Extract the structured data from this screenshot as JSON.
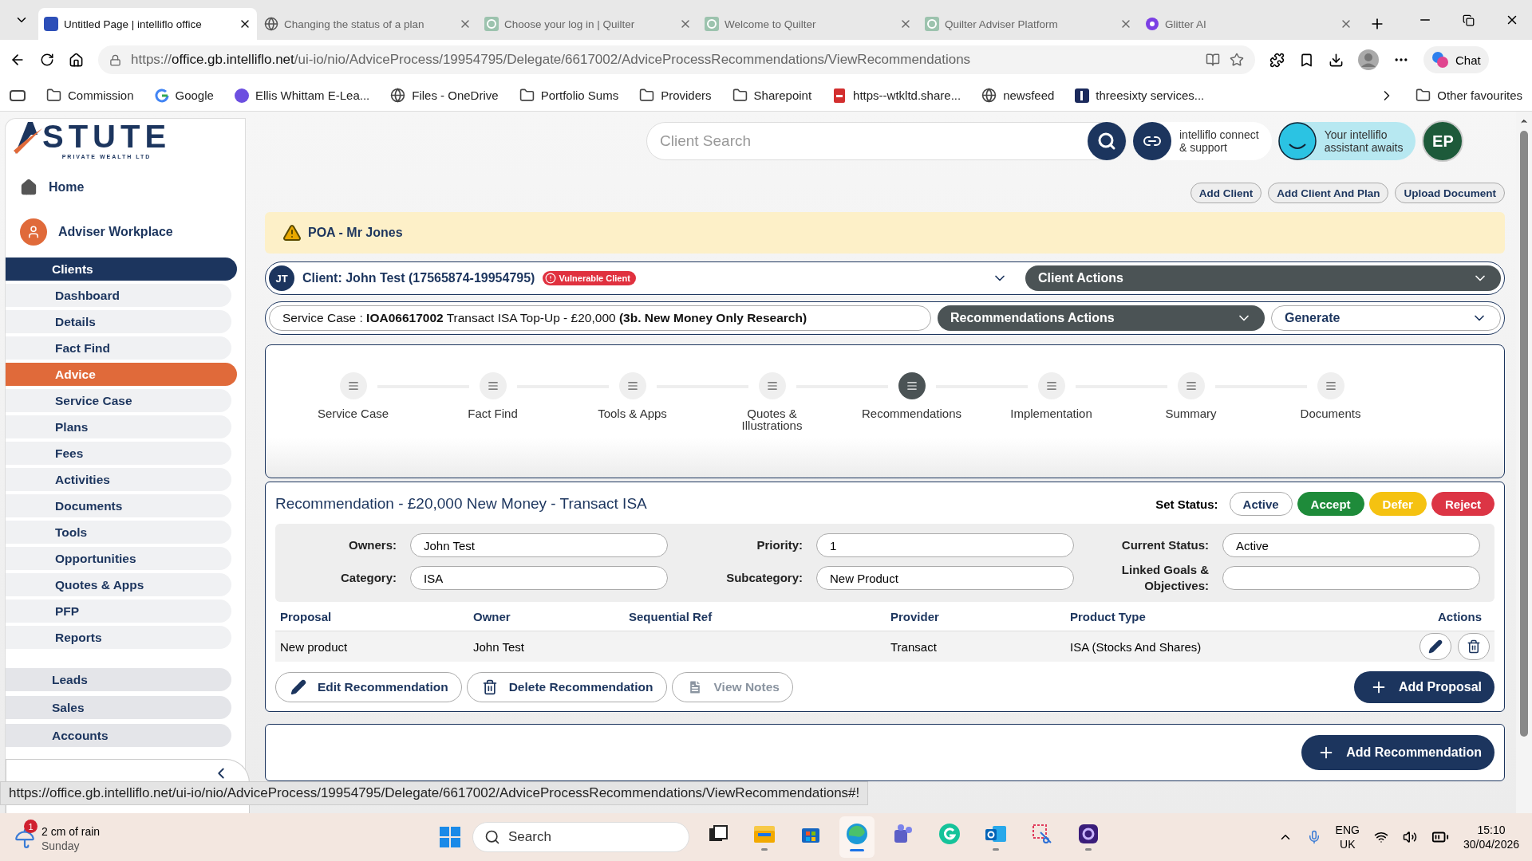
{
  "browser": {
    "tabs": [
      {
        "title": "Untitled Page | intelliflo office",
        "kind": "intelliflo",
        "selected": true
      },
      {
        "title": "Changing the status of a plan",
        "kind": "globe",
        "selected": false
      },
      {
        "title": "Choose your log in | Quilter",
        "kind": "quilter",
        "selected": false
      },
      {
        "title": "Welcome to Quilter",
        "kind": "quilter",
        "selected": false
      },
      {
        "title": "Quilter Adviser Platform",
        "kind": "quilter",
        "selected": false
      },
      {
        "title": "Glitter AI",
        "kind": "glitter",
        "selected": false
      }
    ],
    "url": "https://**office.gb.intelliflo.net**/ui-io/nio/AdviceProcess/19954795/Delegate/6617002/AdviceProcessRecommendations/ViewRecommendations",
    "chat": "Chat",
    "bookmarks": [
      {
        "label": "Commission",
        "kind": "folder"
      },
      {
        "label": "Google",
        "kind": "google"
      },
      {
        "label": "Ellis Whittam E-Lea...",
        "kind": "avatar"
      },
      {
        "label": "Files - OneDrive",
        "kind": "globe"
      },
      {
        "label": "Portfolio Sums",
        "kind": "folder"
      },
      {
        "label": "Providers",
        "kind": "folder"
      },
      {
        "label": "Sharepoint",
        "kind": "folder"
      },
      {
        "label": "https--wtkltd.share...",
        "kind": "pdf"
      },
      {
        "label": "newsfeed",
        "kind": "globe"
      },
      {
        "label": "threesixty services...",
        "kind": "square"
      }
    ],
    "other_favourites": "Other favourites"
  },
  "sidebar": {
    "logo": "STUTE",
    "logo_tagline": "PRIVATE WEALTH LTD",
    "home": "Home",
    "workplace": "Adviser Workplace",
    "items": [
      {
        "label": "Clients",
        "kind": "section",
        "selected": true
      },
      {
        "label": "Dashboard",
        "kind": "sub",
        "selected": false
      },
      {
        "label": "Details",
        "kind": "sub",
        "selected": false
      },
      {
        "label": "Fact Find",
        "kind": "sub",
        "selected": false
      },
      {
        "label": "Advice",
        "kind": "sub",
        "selected": true
      },
      {
        "label": "Service Case",
        "kind": "sub",
        "selected": false
      },
      {
        "label": "Plans",
        "kind": "sub",
        "selected": false
      },
      {
        "label": "Fees",
        "kind": "sub",
        "selected": false
      },
      {
        "label": "Activities",
        "kind": "sub",
        "selected": false
      },
      {
        "label": "Documents",
        "kind": "sub",
        "selected": false
      },
      {
        "label": "Tools",
        "kind": "sub",
        "selected": false
      },
      {
        "label": "Opportunities",
        "kind": "sub",
        "selected": false
      },
      {
        "label": "Quotes & Apps",
        "kind": "sub",
        "selected": false
      },
      {
        "label": "PFP",
        "kind": "sub",
        "selected": false
      },
      {
        "label": "Reports",
        "kind": "sub",
        "selected": false
      },
      {
        "label": "Leads",
        "kind": "section",
        "selected": false
      },
      {
        "label": "Sales",
        "kind": "section",
        "selected": false
      },
      {
        "label": "Accounts",
        "kind": "section",
        "selected": false
      }
    ]
  },
  "header": {
    "search": {
      "placeholder": "Client Search"
    },
    "connect": [
      "intelliflo connect",
      "& support"
    ],
    "assistant": [
      "Your intelliflo",
      "assistant awaits"
    ],
    "user_initials": "EP",
    "quick_actions": [
      "Add Client",
      "Add Client And Plan",
      "Upload Document"
    ]
  },
  "alert": "POA - Mr Jones",
  "client_bar": {
    "initials": "JT",
    "client": "Client: John Test (17565874-19954795)",
    "badge": "Vulnerable Client",
    "actions": "Client Actions"
  },
  "service_bar": {
    "service_case": "Service Case : **IOA06617002** Transact ISA Top-Up - £20,000 **(3b. New Money Only Research)**",
    "recommendation_actions": "Recommendations Actions",
    "generate": "Generate"
  },
  "steps": [
    {
      "label": "Service Case",
      "selected": false
    },
    {
      "label": "Fact Find",
      "selected": false
    },
    {
      "label": "Tools & Apps",
      "selected": false
    },
    {
      "label": "Quotes & Illustrations",
      "selected": false
    },
    {
      "label": "Recommendations",
      "selected": true
    },
    {
      "label": "Implementation",
      "selected": false
    },
    {
      "label": "Summary",
      "selected": false
    },
    {
      "label": "Documents",
      "selected": false
    }
  ],
  "recommendation": {
    "title": "Recommendation - £20,000 New Money - Transact ISA",
    "set_status": "Set Status:",
    "status_buttons": [
      {
        "label": "Active",
        "color": "#ffffff"
      },
      {
        "label": "Accept",
        "color": "#1e8b3a"
      },
      {
        "label": "Defer",
        "color": "#f5c211"
      },
      {
        "label": "Reject",
        "color": "#dc3545"
      }
    ],
    "fields": [
      {
        "label": "Owners:",
        "value": "John Test"
      },
      {
        "label": "Priority:",
        "value": "1"
      },
      {
        "label": "Current Status:",
        "value": "Active"
      },
      {
        "label": "Category:",
        "value": "ISA"
      },
      {
        "label": "Subcategory:",
        "value": "New Product"
      },
      {
        "label": "Linked Goals & Objectives:"
      }
    ],
    "table": {
      "columns": [
        "Proposal",
        "Owner",
        "Sequential Ref",
        "Provider",
        "Product Type",
        "Actions"
      ],
      "rows": [
        {
          "cells": [
            "New product",
            "John Test",
            "",
            "Transact",
            "ISA (Stocks And Shares)"
          ]
        }
      ]
    },
    "buttons": [
      {
        "label": "Edit Recommendation",
        "kind": "edit",
        "disabled": false
      },
      {
        "label": "Delete Recommendation",
        "kind": "delete",
        "disabled": false
      },
      {
        "label": "View Notes",
        "kind": "notes",
        "disabled": true
      }
    ],
    "add_proposal": "Add Proposal"
  },
  "add_recommendation": "Add Recommendation",
  "status_url": "https://office.gb.intelliflo.net/ui-io/nio/AdviceProcess/19954795/Delegate/6617002/AdviceProcessRecommendations/ViewRecommendations#!",
  "taskbar": {
    "weather": "2 cm of rain",
    "day": "Sunday",
    "notifications": "1",
    "search": "Search",
    "apps": [
      {
        "kind": "taskview",
        "running": false,
        "selected": false
      },
      {
        "kind": "explorer",
        "running": true,
        "selected": false
      },
      {
        "kind": "store",
        "running": false,
        "selected": false
      },
      {
        "kind": "edge",
        "running": true,
        "selected": true
      },
      {
        "kind": "teams",
        "running": false,
        "selected": false
      },
      {
        "kind": "grammarly",
        "running": false,
        "selected": false
      },
      {
        "kind": "outlook",
        "running": true,
        "selected": false
      },
      {
        "kind": "snipping",
        "running": false,
        "selected": false
      },
      {
        "kind": "glitter",
        "running": true,
        "selected": false
      }
    ],
    "language": "ENG",
    "region": "UK",
    "time": "15:10",
    "date": "30/04/2026"
  }
}
